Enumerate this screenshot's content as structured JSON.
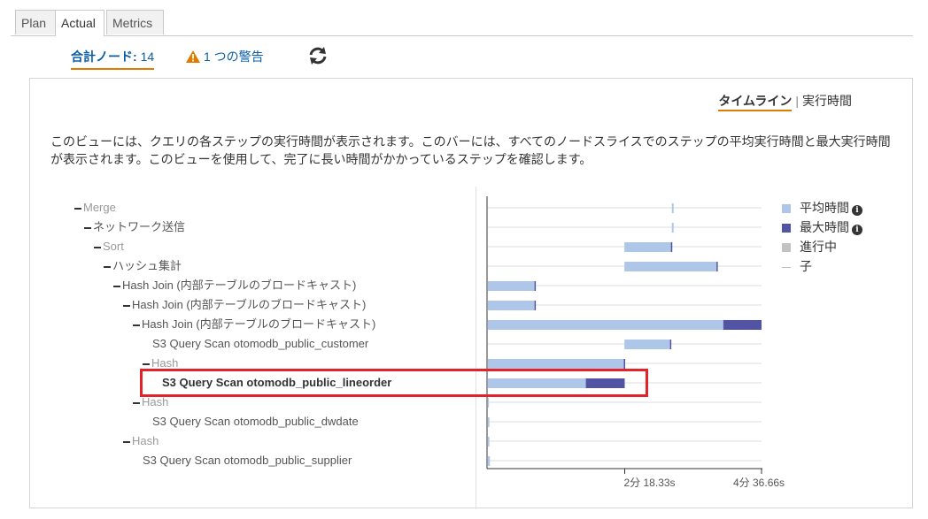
{
  "tabs": [
    {
      "label": "Plan",
      "active": false
    },
    {
      "label": "Actual",
      "active": true
    },
    {
      "label": "Metrics",
      "active": false
    }
  ],
  "summary": {
    "total_label": "合計ノード:",
    "total_count": "14",
    "warning_text": "1 つの警告"
  },
  "view_switch": {
    "timeline": "タイムライン",
    "separator": "|",
    "exec_time": "実行時間"
  },
  "description": "このビューには、クエリの各ステップの実行時間が表示されます。このバーには、すべてのノードスライスでのステップの平均実行時間と最大実行時間が表示されます。このビューを使用して、完了に長い時間がかかっているステップを確認します。",
  "tree": [
    {
      "label": "Merge",
      "has_dash": true,
      "style": "light"
    },
    {
      "label": "ネットワーク送信",
      "has_dash": true,
      "style": "normal"
    },
    {
      "label": "Sort",
      "has_dash": true,
      "style": "light"
    },
    {
      "label": "ハッシュ集計",
      "has_dash": true,
      "style": "normal"
    },
    {
      "label": "Hash Join (内部テーブルのブロードキャスト)",
      "has_dash": true,
      "style": "normal"
    },
    {
      "label": "Hash Join (内部テーブルのブロードキャスト)",
      "has_dash": true,
      "style": "normal"
    },
    {
      "label": "Hash Join (内部テーブルのブロードキャスト)",
      "has_dash": true,
      "style": "normal"
    },
    {
      "label": "S3 Query Scan otomodb_public_customer",
      "has_dash": false,
      "style": "normal"
    },
    {
      "label": "Hash",
      "has_dash": true,
      "style": "light"
    },
    {
      "label": "S3 Query Scan otomodb_public_lineorder",
      "has_dash": false,
      "style": "bold"
    },
    {
      "label": "Hash",
      "has_dash": true,
      "style": "light"
    },
    {
      "label": "S3 Query Scan otomodb_public_dwdate",
      "has_dash": false,
      "style": "normal"
    },
    {
      "label": "Hash",
      "has_dash": true,
      "style": "light"
    },
    {
      "label": "S3 Query Scan otomodb_public_supplier",
      "has_dash": false,
      "style": "normal"
    }
  ],
  "legend": [
    {
      "label": "平均時間",
      "swatch": "#aec7e8",
      "info": true
    },
    {
      "label": "最大時間",
      "swatch": "#5254a3",
      "info": true
    },
    {
      "label": "進行中",
      "swatch": "#c2c2c2",
      "info": false
    },
    {
      "label": "子",
      "swatch": "line",
      "info": false
    }
  ],
  "colors": {
    "avg": "#aec7e8",
    "max": "#5254a3",
    "highlight": "#e2232a",
    "accent": "#e07b00",
    "link": "#0a5ea8"
  },
  "chart_data": {
    "type": "bar",
    "orientation": "horizontal",
    "x_ticks": [
      {
        "seconds": 138.33,
        "label": "2分 18.33s"
      },
      {
        "seconds": 276.66,
        "label": "4分 36.66s"
      }
    ],
    "xlim": [
      0,
      276.66
    ],
    "series": [
      {
        "name": "平均時間"
      },
      {
        "name": "最大時間"
      }
    ],
    "rows": [
      {
        "start": 186,
        "avg_end": 186,
        "max_end": 186.5
      },
      {
        "start": 186,
        "avg_end": 186,
        "max_end": 186.5
      },
      {
        "start": 138,
        "avg_end": 186,
        "max_end": 186
      },
      {
        "start": 138,
        "avg_end": 231,
        "max_end": 232
      },
      {
        "start": 0,
        "avg_end": 47,
        "max_end": 48
      },
      {
        "start": 0,
        "avg_end": 47,
        "max_end": 48
      },
      {
        "start": 0,
        "avg_end": 238,
        "max_end": 276.66
      },
      {
        "start": 138,
        "avg_end": 184,
        "max_end": 185
      },
      {
        "start": 0,
        "avg_end": 138.33,
        "max_end": 138.33
      },
      {
        "start": 0,
        "avg_end": 99,
        "max_end": 138.33
      },
      {
        "start": 0,
        "avg_end": 1,
        "max_end": 1
      },
      {
        "start": 0,
        "avg_end": 1.5,
        "max_end": 1.5
      },
      {
        "start": 0,
        "avg_end": 1.5,
        "max_end": 1.5
      },
      {
        "start": 0,
        "avg_end": 2,
        "max_end": 2
      }
    ]
  }
}
